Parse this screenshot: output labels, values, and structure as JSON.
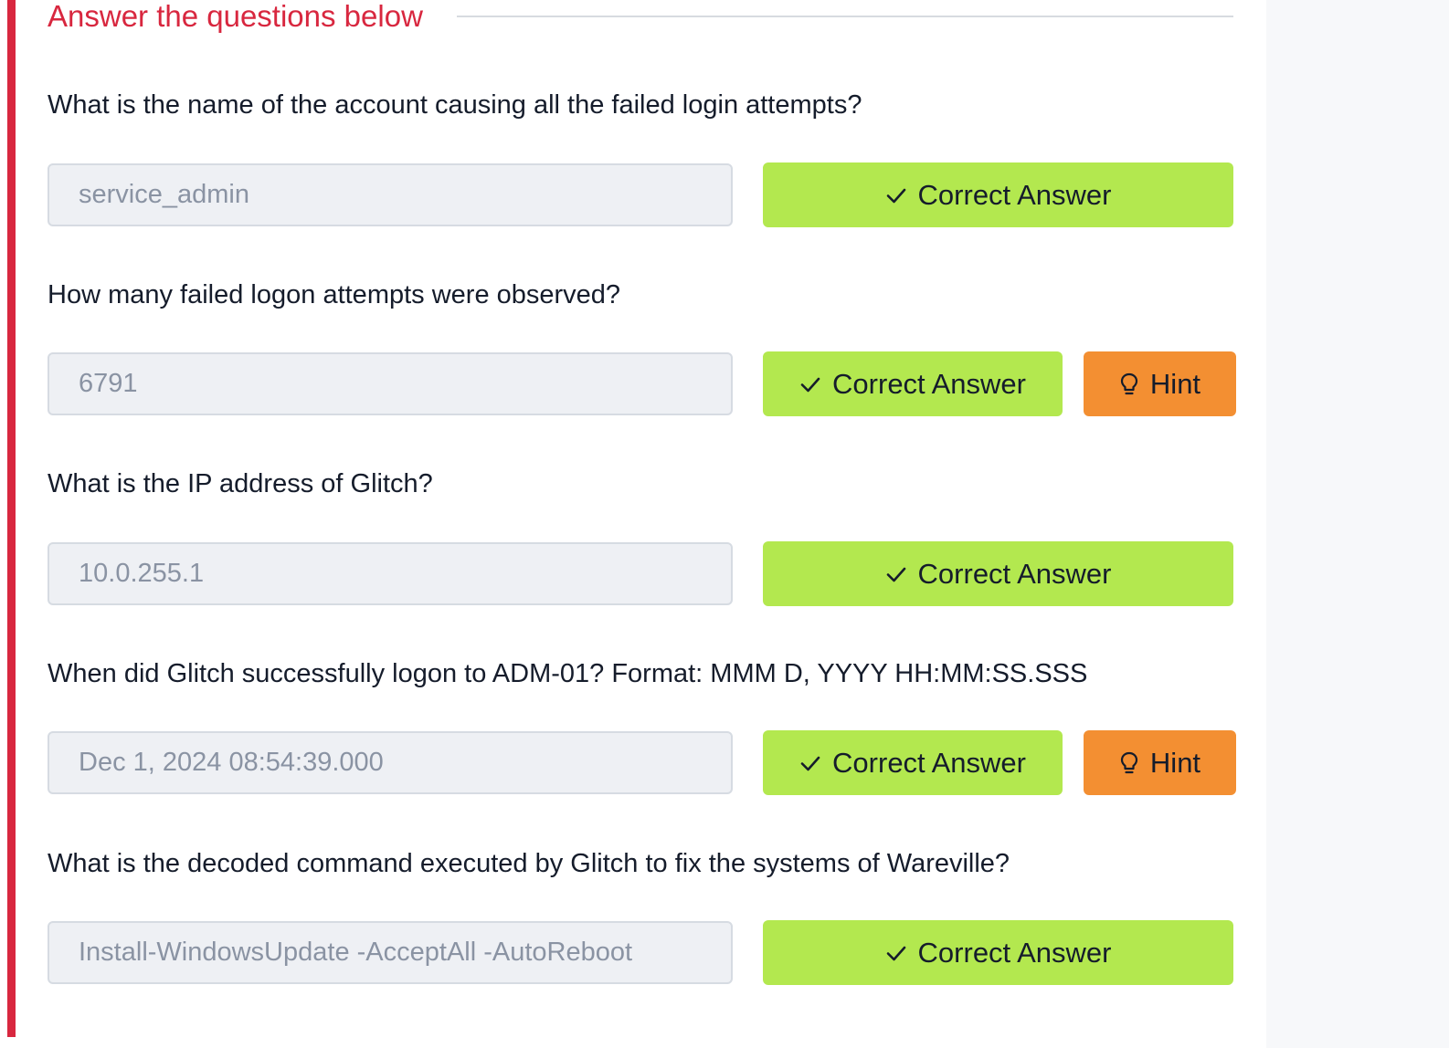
{
  "section": {
    "title": "Answer the questions below"
  },
  "questions": [
    {
      "text": "What is the name of the account causing all the failed login attempts?",
      "answer": "service_admin",
      "correct_label": "Correct Answer"
    },
    {
      "text": "How many failed logon attempts were observed?",
      "answer": "6791",
      "correct_label": "Correct Answer",
      "hint_label": "Hint"
    },
    {
      "text": "What is the IP address of Glitch?",
      "answer": "10.0.255.1",
      "correct_label": "Correct Answer"
    },
    {
      "text": "When did Glitch successfully logon to ADM-01? Format: MMM D, YYYY HH:MM:SS.SSS",
      "answer": "Dec 1, 2024 08:54:39.000",
      "correct_label": "Correct Answer",
      "hint_label": "Hint"
    },
    {
      "text": "What is the decoded command executed by Glitch to fix the systems of Wareville?",
      "answer": "Install-WindowsUpdate -AcceptAll -AutoReboot",
      "correct_label": "Correct Answer"
    }
  ],
  "icons": {
    "correct": "check-icon",
    "hint": "lightbulb-icon"
  },
  "colors": {
    "accent": "#d8273f",
    "correct_button": "#b3e84f",
    "hint_button": "#f38f32"
  }
}
